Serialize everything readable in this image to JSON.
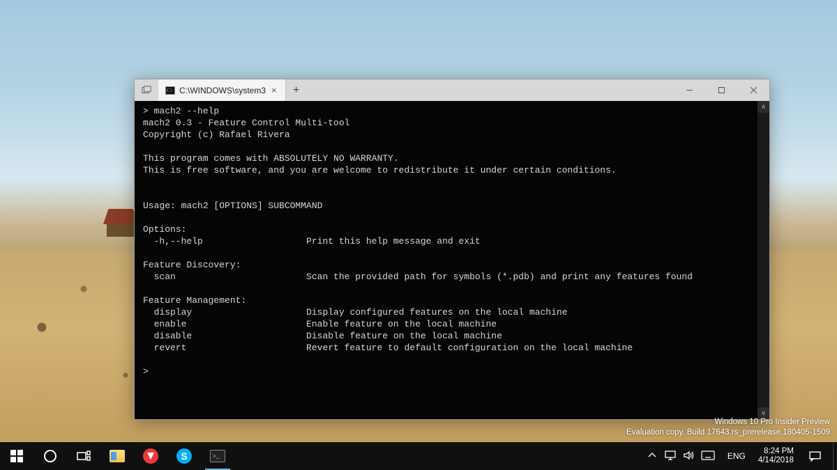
{
  "window": {
    "tab_title": "C:\\WINDOWS\\system3",
    "tab_close": "×",
    "new_tab": "+"
  },
  "terminal": {
    "lines": "> mach2 --help\nmach2 0.3 - Feature Control Multi-tool\nCopyright (c) Rafael Rivera\n\nThis program comes with ABSOLUTELY NO WARRANTY.\nThis is free software, and you are welcome to redistribute it under certain conditions.\n\n\nUsage: mach2 [OPTIONS] SUBCOMMAND\n\nOptions:\n  -h,--help                   Print this help message and exit\n\nFeature Discovery:\n  scan                        Scan the provided path for symbols (*.pdb) and print any features found\n\nFeature Management:\n  display                     Display configured features on the local machine\n  enable                      Enable feature on the local machine\n  disable                     Disable feature on the local machine\n  revert                      Revert feature to default configuration on the local machine\n\n>"
  },
  "watermark": {
    "line1": "Windows 10 Pro Insider Preview",
    "line2": "Evaluation copy. Build 17643.rs_prerelease.180405-1509"
  },
  "taskbar": {
    "lang": "ENG",
    "time": "8:24 PM",
    "date": "4/14/2018",
    "skype_letter": "S"
  }
}
